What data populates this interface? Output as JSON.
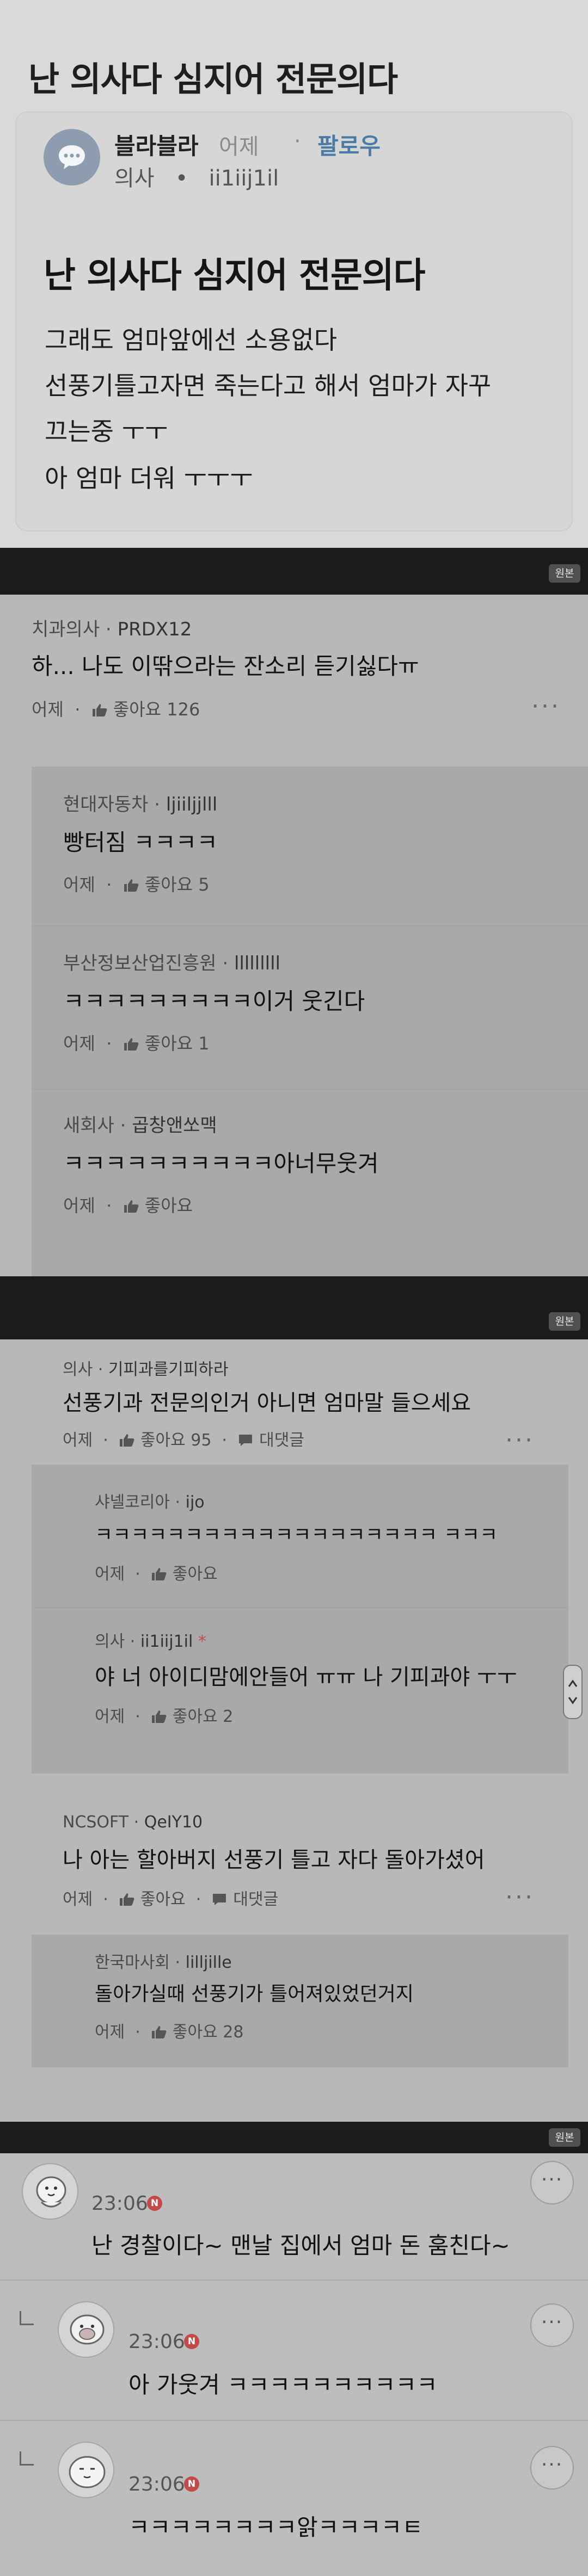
{
  "page_title": "난 의사다 심지어 전문의다",
  "post": {
    "author": "블라블라",
    "time": "어제",
    "follow": "팔로우",
    "author_company": "의사",
    "author_id": "ii1iij1il",
    "heading": "난 의사다 심지어 전문의다",
    "lines": [
      "그래도 엄마앞에선 소용없다",
      "선풍기틀고자면 죽는다고 해서 엄마가 자꾸",
      "끄는중 ㅜㅜ",
      "아 엄마 더워 ㅜㅜㅜ"
    ]
  },
  "original_badge": "원본",
  "section2": {
    "top": {
      "company": "치과의사",
      "nick": "PRDX12",
      "body": "하... 나도 이딲으라는 잔소리 듣기싫다ㅠ",
      "time": "어제",
      "likes": "좋아요 126"
    },
    "replies": [
      {
        "company": "현대자동차",
        "nick": "ljiiljjlll",
        "body": "빵터짐 ㅋㅋㅋㅋ",
        "time": "어제",
        "likes": "좋아요 5"
      },
      {
        "company": "부산정보산업진흥원",
        "nick": "lllllllll",
        "body": "ㅋㅋㅋㅋㅋㅋㅋㅋㅋ이거 웃긴다",
        "time": "어제",
        "likes": "좋아요 1"
      },
      {
        "company": "새회사",
        "nick": "곱창앤쏘맥",
        "body": "ㅋㅋㅋㅋㅋㅋㅋㅋㅋㅋ아너무웃겨",
        "time": "어제",
        "likes": "좋아요"
      }
    ]
  },
  "section3": {
    "top": {
      "company": "의사",
      "nick": "기피과를기피하라",
      "body": "선풍기과 전문의인거 아니면 엄마말 들으세요",
      "time": "어제",
      "likes": "좋아요 95",
      "reply_label": "대댓글"
    },
    "replies": [
      {
        "company": "샤넬코리아",
        "nick": "ijo",
        "body": "ㅋㅋㅋㅋㅋㅋㅋㅋㅋㅋㅋㅋㅋㅋㅋㅋㅋㅋㅋ ㅋㅋㅋ",
        "time": "어제",
        "likes": "좋아요"
      },
      {
        "company": "의사",
        "nick": "ii1iij1il",
        "writer_mark": "*",
        "body": "야 너 아이디맘에안들어 ㅠㅠ 나 기피과야 ㅜㅜ",
        "time": "어제",
        "likes": "좋아요 2"
      }
    ],
    "top2": {
      "company": "NCSOFT",
      "nick": "QeIY10",
      "body": "나 아는 할아버지 선풍기 틀고 자다 돌아가셨어",
      "time": "어제",
      "likes": "좋아요",
      "reply_label": "대댓글"
    },
    "replies2": [
      {
        "company": "한국마사회",
        "nick": "lilljille",
        "body": "돌아가실때 선풍기가 틀어져있었던거지",
        "time": "어제",
        "likes": "좋아요 28"
      }
    ]
  },
  "section4": {
    "items": [
      {
        "time": "23:06",
        "badge": "N",
        "text": "난 경찰이다~ 맨날 집에서 엄마 돈 훔친다~"
      },
      {
        "time": "23:06",
        "badge": "N",
        "text": "아 가웃겨 ㅋㅋㅋㅋㅋㅋㅋㅋㅋㅋ"
      },
      {
        "time": "23:06",
        "badge": "N",
        "text": "ㅋㅋㅋㅋㅋㅋㅋㅋ앍ㅋㅋㅋㅋㅌ"
      }
    ],
    "more_label": "···"
  },
  "icons": {
    "dot": "·",
    "more": "···",
    "chat": "speech-bubble-icon",
    "like": "thumb-up-icon",
    "reply": "comment-icon"
  },
  "colors": {
    "accent": "#4a7aa6",
    "badge": "#c24a4a"
  }
}
